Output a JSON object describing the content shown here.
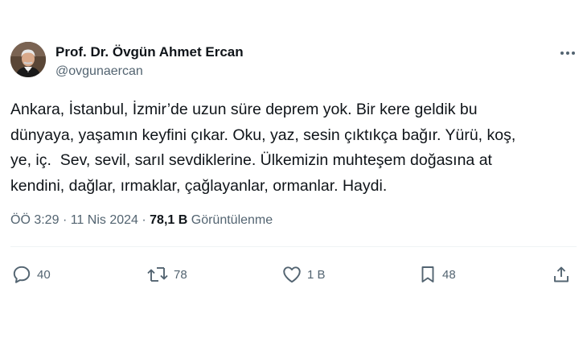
{
  "author": {
    "name": "Prof. Dr. Övgün Ahmet Ercan",
    "handle": "@ovgunaercan"
  },
  "tweet": {
    "text": "Ankara, İstanbul, İzmir’de uzun süre deprem yok. Bir kere geldik bu\ndünyaya, yaşamın keyfini çıkar. Oku, yaz, sesin çıktıkça bağır. Yürü, koş,\nye, iç.  Sev, sevil, sarıl sevdiklerine. Ülkemizin muhteşem doğasına at\nkendini, dağlar, ırmaklar, çağlayanlar, ormanlar. Haydi.",
    "time": "ÖÖ 3:29",
    "separator": "·",
    "date": "11 Nis 2024",
    "views": "78,1 B",
    "views_label": "Görüntülenme"
  },
  "actions": {
    "replies": "40",
    "retweets": "78",
    "likes": "1 B",
    "bookmarks": "48"
  },
  "icons": {
    "more": "more-horizontal-icon",
    "reply": "reply-icon",
    "retweet": "retweet-icon",
    "like": "heart-icon",
    "bookmark": "bookmark-icon",
    "share": "share-icon"
  },
  "colors": {
    "text": "#0f1419",
    "secondary": "#536471",
    "divider": "#eff3f4"
  }
}
